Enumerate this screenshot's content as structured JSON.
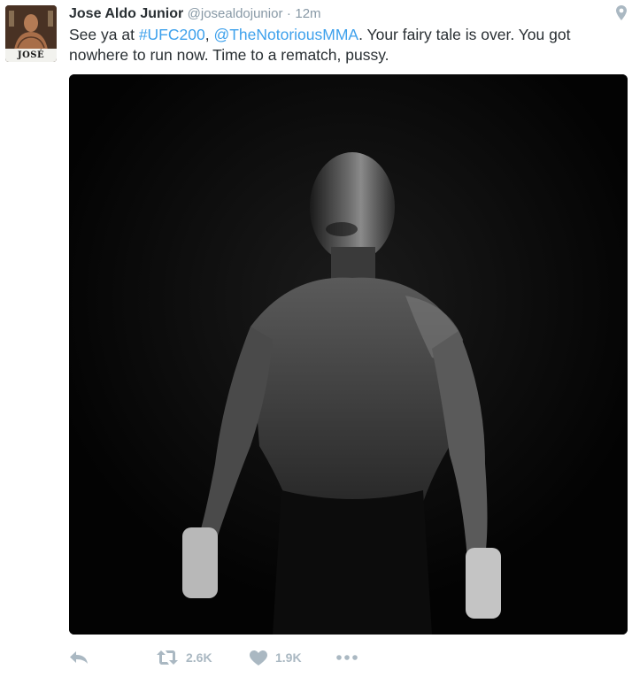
{
  "tweet": {
    "author_name": "Jose Aldo Junior",
    "handle": "@josealdojunior",
    "separator": "·",
    "time": "12m",
    "avatar_caption": "JOSÉ ALDO",
    "text": {
      "prefix": "See ya at ",
      "hashtag": "#UFC200",
      "comma": ", ",
      "mention": "@TheNotoriousMMA",
      "rest": ". Your fairy tale is over. You got nowhere to run now. Time to a rematch, pussy."
    },
    "photo_icon": "fighter-photo",
    "actions": {
      "reply_icon": "reply-icon",
      "retweet_icon": "retweet-icon",
      "retweet_count": "2.6K",
      "like_icon": "heart-icon",
      "like_count": "1.9K",
      "more_icon": "more-icon"
    },
    "location_icon": "location-pin-icon"
  },
  "colors": {
    "link": "#3ea1ec",
    "text": "#292f33",
    "muted": "#8899a6",
    "action": "#aab8c2"
  }
}
